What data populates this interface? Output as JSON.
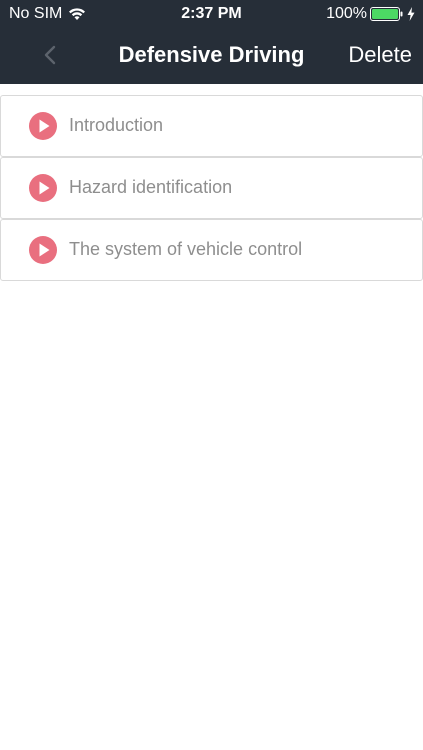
{
  "status_bar": {
    "carrier": "No SIM",
    "time": "2:37 PM",
    "battery": "100%",
    "battery_color": "#4cd964"
  },
  "nav": {
    "title": "Defensive Driving",
    "back_icon": "chevron-left-icon",
    "delete_label": "Delete"
  },
  "colors": {
    "header_bg": "#262e38",
    "play_icon": "#e96f7f",
    "item_text": "#8e8e8e"
  },
  "lessons": [
    {
      "label": "Introduction"
    },
    {
      "label": "Hazard identification"
    },
    {
      "label": "The system of vehicle control"
    }
  ]
}
